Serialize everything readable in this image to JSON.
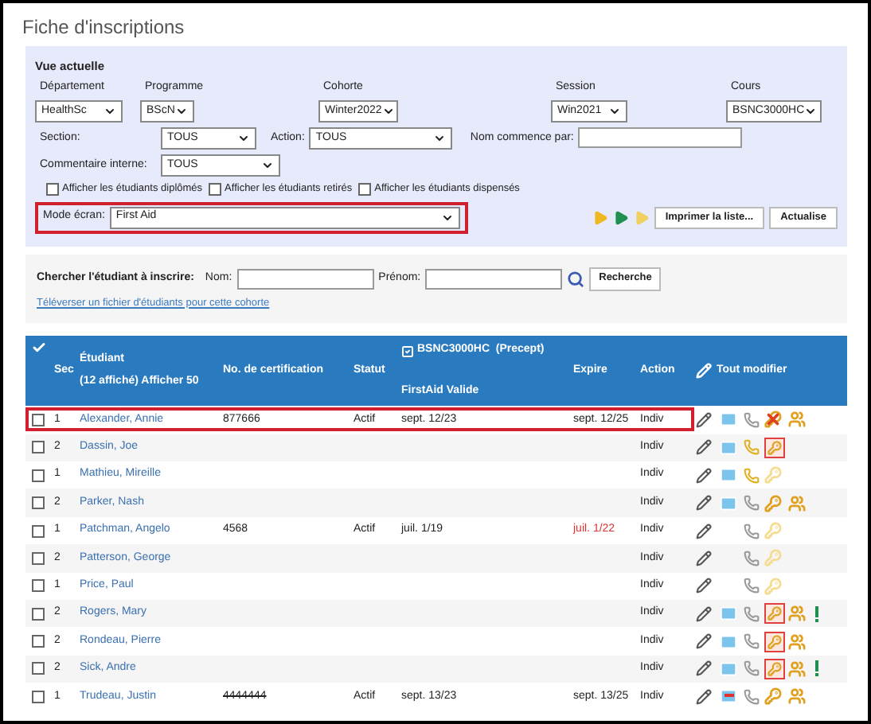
{
  "title": "Fiche d'inscriptions",
  "filters": {
    "heading": "Vue actuelle",
    "selects": [
      {
        "label": "Département",
        "value": "HealthSc"
      },
      {
        "label": "Programme",
        "value": "BScN"
      },
      {
        "label": "Cohorte",
        "value": "Winter2022"
      },
      {
        "label": "Session",
        "value": "Win2021"
      },
      {
        "label": "Cours",
        "value": "BSNC3000HC"
      }
    ],
    "section": {
      "label": "Section:",
      "value": "TOUS"
    },
    "action": {
      "label": "Action:",
      "value": "TOUS"
    },
    "name_starts": {
      "label": "Nom commence par:"
    },
    "comment": {
      "label": "Commentaire interne:",
      "value": "TOUS"
    },
    "checkboxes": [
      {
        "label": "Afficher les étudiants diplômés",
        "checked": false
      },
      {
        "label": "Afficher les étudiants retirés",
        "checked": false
      },
      {
        "label": "Afficher les étudiants dispensés",
        "checked": false
      }
    ],
    "mode": {
      "label": "Mode écran:",
      "value": "First Aid",
      "highlighted": true
    },
    "buttons": [
      "Imprimer la liste...",
      "Actualise"
    ]
  },
  "search": {
    "label": "Chercher l'étudiant à inscrire:",
    "last_name_label": "Nom:",
    "first_name_label": "Prénom:",
    "button": "Recherche",
    "upload_link": "Téléverser un fichier d'étudiants pour cette cohorte"
  },
  "table": {
    "columns": {
      "sec": "Sec",
      "student": "Étudiant",
      "student_sub": "(12 affiché) Afficher 50",
      "cert": "No. de certification",
      "status": "Statut",
      "course": "BSNC3000HC  (Precept)",
      "course_checked": true,
      "firstaid": "FirstAid Valide",
      "expire": "Expire",
      "action": "Action",
      "edit_all": "Tout modifier"
    },
    "rows": [
      {
        "checked": false,
        "sec": "1",
        "name": "Alexander, Annie",
        "cert": "877666",
        "cert_struck": false,
        "status": "Actif",
        "valid": "sept. 12/23",
        "expire": "sept. 12/25",
        "expired": false,
        "action": "Indiv",
        "highlighted": true,
        "icons": [
          {
            "kind": "pencil"
          },
          {
            "kind": "mail"
          },
          {
            "kind": "phone"
          },
          {
            "kind": "crossedkey"
          },
          {
            "kind": "users"
          }
        ]
      },
      {
        "checked": false,
        "sec": "2",
        "name": "Dassin, Joe",
        "action": "Indiv",
        "highlighted": false,
        "icons": [
          {
            "kind": "pencil"
          },
          {
            "kind": "mail"
          },
          {
            "kind": "goldphone"
          },
          {
            "kind": "boxedkey"
          }
        ]
      },
      {
        "checked": false,
        "sec": "1",
        "name": "Mathieu, Mireille",
        "action": "Indiv",
        "highlighted": false,
        "icons": [
          {
            "kind": "pencil"
          },
          {
            "kind": "mail"
          },
          {
            "kind": "goldphone"
          },
          {
            "kind": "palekey"
          }
        ]
      },
      {
        "checked": false,
        "sec": "2",
        "name": "Parker, Nash",
        "action": "Indiv",
        "highlighted": false,
        "icons": [
          {
            "kind": "pencil"
          },
          {
            "kind": "mail"
          },
          {
            "kind": "phone"
          },
          {
            "kind": "key"
          },
          {
            "kind": "users"
          }
        ]
      },
      {
        "checked": false,
        "sec": "1",
        "name": "Patchman, Angelo",
        "cert": "4568",
        "cert_struck": false,
        "status": "Actif",
        "valid": "juil. 1/19",
        "expire": "juil. 1/22",
        "expired": true,
        "action": "Indiv",
        "highlighted": false,
        "icons": [
          {
            "kind": "pencil"
          },
          {
            "kind": "phone"
          },
          {
            "kind": "palekey"
          }
        ]
      },
      {
        "checked": false,
        "sec": "2",
        "name": "Patterson, George",
        "action": "Indiv",
        "highlighted": false,
        "icons": [
          {
            "kind": "pencil"
          },
          {
            "kind": "phone"
          },
          {
            "kind": "palekey"
          }
        ]
      },
      {
        "checked": false,
        "sec": "1",
        "name": "Price, Paul",
        "action": "Indiv",
        "highlighted": false,
        "icons": [
          {
            "kind": "pencil"
          },
          {
            "kind": "phone"
          },
          {
            "kind": "palekey"
          }
        ]
      },
      {
        "checked": false,
        "sec": "2",
        "name": "Rogers, Mary",
        "action": "Indiv",
        "highlighted": false,
        "icons": [
          {
            "kind": "pencil"
          },
          {
            "kind": "mail"
          },
          {
            "kind": "phone"
          },
          {
            "kind": "boxedkey"
          },
          {
            "kind": "users"
          },
          {
            "kind": "alert"
          }
        ]
      },
      {
        "checked": false,
        "sec": "2",
        "name": "Rondeau, Pierre",
        "action": "Indiv",
        "highlighted": false,
        "icons": [
          {
            "kind": "pencil"
          },
          {
            "kind": "mail"
          },
          {
            "kind": "phone"
          },
          {
            "kind": "boxedkey"
          },
          {
            "kind": "users"
          }
        ]
      },
      {
        "checked": false,
        "sec": "2",
        "name": "Sick, Andre",
        "action": "Indiv",
        "highlighted": false,
        "icons": [
          {
            "kind": "pencil"
          },
          {
            "kind": "mail"
          },
          {
            "kind": "phone"
          },
          {
            "kind": "boxedkey"
          },
          {
            "kind": "users"
          },
          {
            "kind": "alert"
          }
        ]
      },
      {
        "checked": false,
        "sec": "1",
        "name": "Trudeau, Justin",
        "cert": "4444444",
        "cert_struck": true,
        "status": "Actif",
        "valid": "sept. 13/23",
        "expire": "sept. 13/25",
        "expired": false,
        "action": "Indiv",
        "highlighted": false,
        "icons": [
          {
            "kind": "pencil"
          },
          {
            "kind": "forwardmail"
          },
          {
            "kind": "phone"
          },
          {
            "kind": "key"
          },
          {
            "kind": "users"
          }
        ]
      }
    ]
  }
}
